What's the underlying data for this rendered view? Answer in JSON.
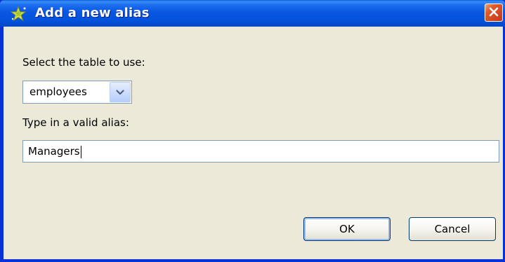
{
  "window": {
    "title": "Add a new alias",
    "titlebar_color": "#0a56e2",
    "title_icon": "sparkle-star-icon",
    "close_icon": "close-x-icon"
  },
  "form": {
    "table_label": "Select the table to use:",
    "table_select": {
      "value": "employees",
      "arrow_icon": "chevron-down-icon"
    },
    "alias_label": "Type in a valid alias:",
    "alias_input": {
      "value": "Managers"
    }
  },
  "buttons": {
    "ok_label": "OK",
    "cancel_label": "Cancel"
  }
}
